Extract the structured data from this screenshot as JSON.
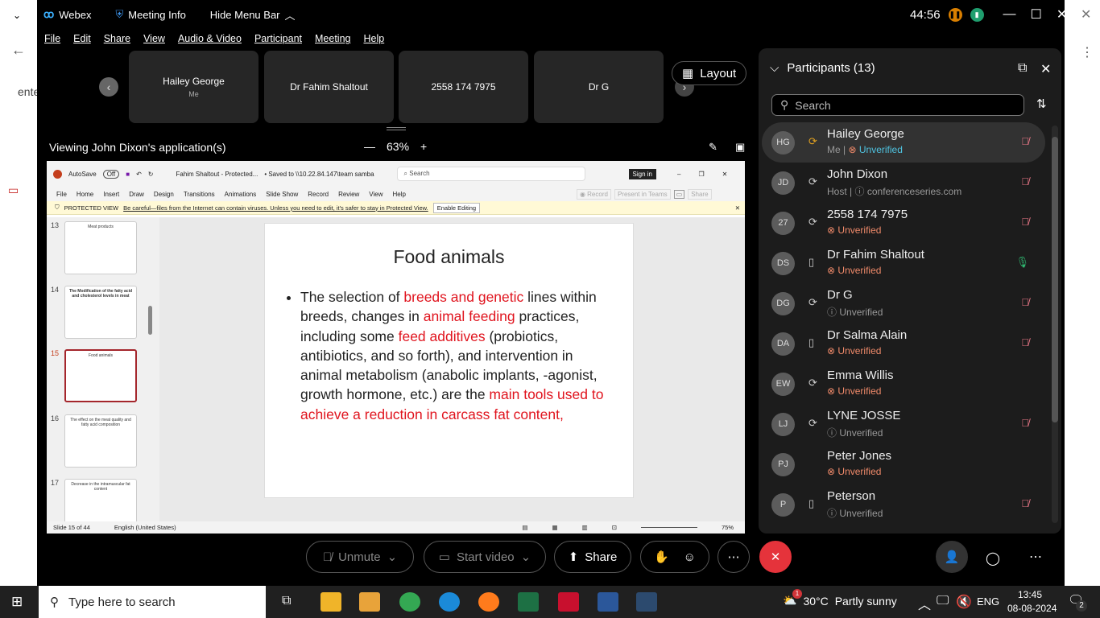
{
  "browser": {
    "partial_text": "ente"
  },
  "webex": {
    "app_name": "Webex",
    "meeting_info": "Meeting Info",
    "hide_menu_bar": "Hide Menu Bar",
    "timer": "44:56",
    "menu": [
      "File",
      "Edit",
      "Share",
      "View",
      "Audio & Video",
      "Participant",
      "Meeting",
      "Help"
    ],
    "video_tiles": [
      {
        "name": "Hailey George",
        "sub": "Me"
      },
      {
        "name": "Dr Fahim Shaltout"
      },
      {
        "name": "2558 174 7975"
      },
      {
        "name": "Dr G"
      }
    ],
    "layout_label": "Layout",
    "viewing_label": "Viewing John Dixon's application(s)",
    "zoom": "63%",
    "controls": {
      "unmute": "Unmute",
      "start_video": "Start video",
      "share": "Share"
    }
  },
  "powerpoint": {
    "autosave": "AutoSave",
    "autosave_state": "Off",
    "file_title": "Fahim Shaltout  -  Protected...",
    "saved_to": "•  Saved to \\\\10.22.84.147\\team samba",
    "search_placeholder": "Search",
    "sign_in": "Sign in",
    "tabs": [
      "File",
      "Home",
      "Insert",
      "Draw",
      "Design",
      "Transitions",
      "Animations",
      "Slide Show",
      "Record",
      "Review",
      "View",
      "Help"
    ],
    "record": "Record",
    "present_teams": "Present in Teams",
    "share": "Share",
    "protected_label": "PROTECTED VIEW",
    "protected_msg": "Be careful—files from the Internet can contain viruses. Unless you need to edit, it's safer to stay in Protected View.",
    "enable_editing": "Enable Editing",
    "thumbnails": [
      {
        "num": "13",
        "title": "Meat products"
      },
      {
        "num": "14",
        "title": "The Modification of the fatty acid and cholesterol levels in meat"
      },
      {
        "num": "15",
        "title": "Food animals"
      },
      {
        "num": "16",
        "title": "The effect on the meat quality and fatty acid composition"
      },
      {
        "num": "17",
        "title": "Decrease in the intramuscular fat content"
      }
    ],
    "slide": {
      "title": "Food animals",
      "t1": "The selection of ",
      "r1": "breeds and genetic",
      "t2": " lines within breeds, changes in ",
      "r2": "animal feeding",
      "t3": " practices, including some ",
      "r3": "feed additives",
      "t4": " (probiotics, antibiotics, and so forth), and intervention in animal metabolism (anabolic implants, -agonist, growth hormone, etc.) are the ",
      "r4": "main tools used to achieve a reduction in carcass fat content,"
    },
    "status": {
      "slide": "Slide 15 of 44",
      "language": "English (United States)",
      "zoom": "75%"
    }
  },
  "participants": {
    "title": "Participants (13)",
    "search_placeholder": "Search",
    "list": [
      {
        "initials": "HG",
        "name": "Hailey George",
        "role": "Me",
        "status": "Unverified",
        "status_kind": "me",
        "device": "sync",
        "mic": "muted"
      },
      {
        "initials": "JD",
        "name": "John Dixon",
        "role": "Host",
        "status": "conferenceseries.com",
        "status_kind": "info",
        "device": "sync",
        "mic": "muted"
      },
      {
        "initials": "27",
        "name": "2558 174 7975",
        "status": "Unverified",
        "status_kind": "x",
        "device": "sync",
        "mic": "muted"
      },
      {
        "initials": "DS",
        "name": "Dr Fahim Shaltout",
        "status": "Unverified",
        "status_kind": "x",
        "device": "phone",
        "mic": "on"
      },
      {
        "initials": "DG",
        "name": "Dr G",
        "status": "Unverified",
        "status_kind": "q",
        "device": "sync",
        "mic": "muted"
      },
      {
        "initials": "DA",
        "name": "Dr Salma Alain",
        "status": "Unverified",
        "status_kind": "x",
        "device": "phone",
        "mic": "muted"
      },
      {
        "initials": "EW",
        "name": "Emma Willis",
        "status": "Unverified",
        "status_kind": "x",
        "device": "sync",
        "mic": "none"
      },
      {
        "initials": "LJ",
        "name": "LYNE JOSSE",
        "status": "Unverified",
        "status_kind": "q",
        "device": "sync",
        "mic": "muted"
      },
      {
        "initials": "PJ",
        "name": "Peter Jones",
        "status": "Unverified",
        "status_kind": "x",
        "device": "none",
        "mic": "none"
      },
      {
        "initials": "P",
        "name": "Peterson",
        "status": "Unverified",
        "status_kind": "q",
        "device": "phone",
        "mic": "muted"
      }
    ]
  },
  "taskbar": {
    "search_placeholder": "Type here to search",
    "weather_temp": "30°C",
    "weather_text": "Partly sunny",
    "weather_badge": "1",
    "lang": "ENG",
    "time": "13:45",
    "date": "08-08-2024",
    "notifications": "2"
  },
  "colors": {
    "accent_red": "#e0141e",
    "end_call": "#e5333b",
    "unverified": "#f08a6a",
    "me_status": "#4fc3e0"
  }
}
